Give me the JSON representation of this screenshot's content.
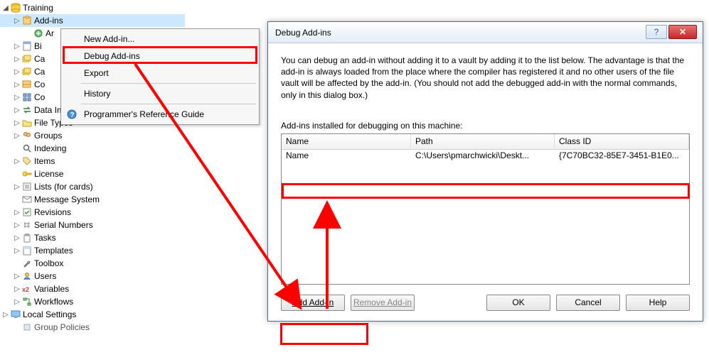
{
  "tree": {
    "root": "Training",
    "items": [
      {
        "label": "Add-ins",
        "selected": true
      },
      {
        "label": "Ar"
      },
      {
        "label": "Bi"
      },
      {
        "label": "Ca"
      },
      {
        "label": "Ca"
      },
      {
        "label": "Co"
      },
      {
        "label": "Co"
      },
      {
        "label": "Data Import/Export"
      },
      {
        "label": "File Types"
      },
      {
        "label": "Groups"
      },
      {
        "label": "Indexing"
      },
      {
        "label": "Items"
      },
      {
        "label": "License"
      },
      {
        "label": "Lists (for cards)"
      },
      {
        "label": "Message System"
      },
      {
        "label": "Revisions"
      },
      {
        "label": "Serial Numbers"
      },
      {
        "label": "Tasks"
      },
      {
        "label": "Templates"
      },
      {
        "label": "Toolbox"
      },
      {
        "label": "Users"
      },
      {
        "label": "Variables"
      },
      {
        "label": "Workflows"
      }
    ],
    "local_settings": "Local Settings",
    "group_policies": "Group Policies"
  },
  "context_menu": {
    "items": [
      "New Add-in...",
      "Debug Add-ins",
      "Export",
      "History",
      "Programmer's Reference Guide"
    ]
  },
  "dialog": {
    "title": "Debug Add-ins",
    "info": "You can debug an add-in without adding it to a vault by adding it to the list below. The advantage is that the add-in is always loaded from the place where the compiler has registered it and no other users of the file vault will be affected by the add-in. (You should not add the debugged add-in with the normal commands, only in this dialog box.)",
    "list_label": "Add-ins installed for debugging on this machine:",
    "columns": {
      "name": "Name",
      "path": "Path",
      "class": "Class ID"
    },
    "row": {
      "name": "Name",
      "path": "C:\\Users\\pmarchwicki\\Deskt...",
      "class": "{7C70BC32-85E7-3451-B1E0..."
    },
    "buttons": {
      "add": "Add Add-in",
      "remove": "Remove Add-in",
      "ok": "OK",
      "cancel": "Cancel",
      "help": "Help"
    }
  }
}
